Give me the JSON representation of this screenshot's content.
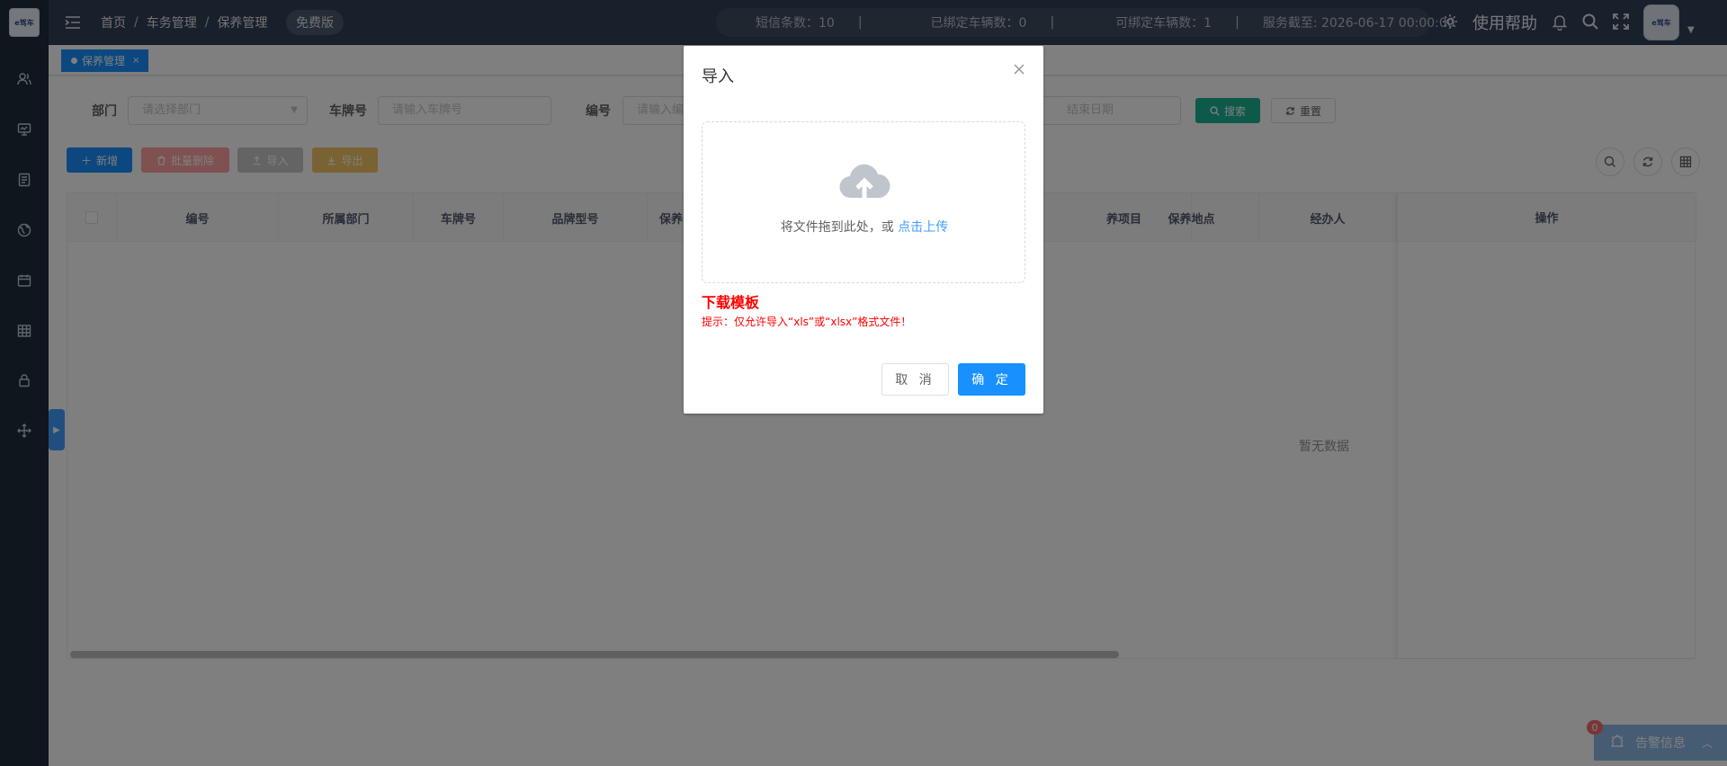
{
  "sidebar": {
    "logo_text": "e驾车"
  },
  "navbar": {
    "breadcrumb": [
      "首页",
      "车务管理",
      "保养管理"
    ],
    "breadcrumb_sep": "/",
    "edition": "免费版",
    "stats": {
      "sms": "短信条数：10",
      "bound": "已绑定车辆数：0",
      "bindable": "可绑定车辆数：1",
      "service_until": "服务截至: 2026-06-17 00:00:00",
      "sep": "|"
    },
    "help": "使用帮助",
    "avatar_text": "e驾车"
  },
  "tags": {
    "active": "保养管理",
    "close": "×"
  },
  "filters": {
    "dept_label": "部门",
    "dept_placeholder": "请选择部门",
    "plate_label": "车牌号",
    "plate_placeholder": "请输入车牌号",
    "code_label": "编号",
    "code_placeholder": "请输入编",
    "end_date_placeholder": "结束日期",
    "search": "搜索",
    "reset": "重置"
  },
  "toolbar": {
    "add": "新增",
    "batch_delete": "批量删除",
    "import": "导入",
    "export": "导出"
  },
  "table": {
    "columns": [
      "编号",
      "所属部门",
      "车牌号",
      "品牌型号",
      "保养",
      "养项目",
      "保养地点",
      "经办人",
      "操作"
    ],
    "empty": "暂无数据"
  },
  "alarm": {
    "count": "0",
    "label": "告警信息"
  },
  "dialog": {
    "title": "导入",
    "drop_text": "将文件拖到此处，或 ",
    "drop_link": "点击上传",
    "download": "下载模板",
    "tip": "提示：仅允许导入“xls”或“xlsx”格式文件！",
    "cancel": "取 消",
    "ok": "确 定"
  },
  "colors": {
    "sidebar_bg": "#1f2d3d",
    "navbar_bg": "#304156",
    "primary": "#1890ff",
    "danger_text": "#ff0000"
  }
}
